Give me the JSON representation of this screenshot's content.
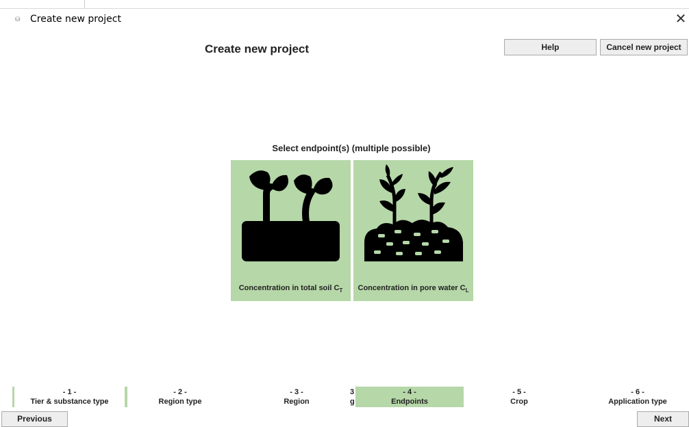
{
  "window": {
    "title": "Create new project",
    "close_glyph": "✕",
    "icon": "app-icon"
  },
  "header": {
    "title": "Create new project",
    "help_label": "Help",
    "cancel_label": "Cancel new project"
  },
  "main": {
    "prompt": "Select endpoint(s) (multiple possible)",
    "tiles": [
      {
        "label": "Concentration in total soil C",
        "subscript": "T",
        "icon": "seedling-soil-icon",
        "selected": true
      },
      {
        "label": "Concentration in pore water C",
        "subscript": "L",
        "icon": "plants-pore-water-icon",
        "selected": true
      }
    ]
  },
  "steps": [
    {
      "num": "- 1 -",
      "label": "Tier & substance type"
    },
    {
      "num": "- 2 -",
      "label": "Region type"
    },
    {
      "num": "- 3 -",
      "label": "Region"
    },
    {
      "num": "- 4 -",
      "label": "Endpoints",
      "active": true
    },
    {
      "num": "- 5 -",
      "label": "Crop"
    },
    {
      "num": "- 6 -",
      "label": "Application type"
    }
  ],
  "step_overlap": {
    "num": "3",
    "label": "g"
  },
  "footer": {
    "previous_label": "Previous",
    "next_label": "Next"
  },
  "colors": {
    "selected_green": "#b6d7a8",
    "button_bg": "#eeeeee"
  }
}
